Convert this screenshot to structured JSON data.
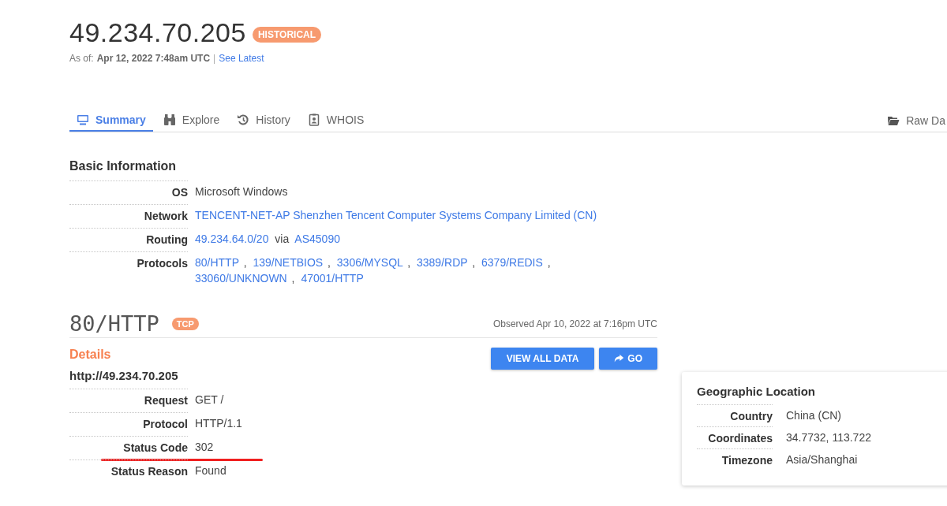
{
  "header": {
    "ip": "49.234.70.205",
    "badge": "HISTORICAL",
    "as_of_label": "As of:",
    "as_of": "Apr 12, 2022 7:48am UTC",
    "separator": "|",
    "latest_link": "See Latest"
  },
  "tabs": [
    {
      "label": "Summary",
      "selected": true
    },
    {
      "label": "Explore",
      "selected": false
    },
    {
      "label": "History",
      "selected": false
    },
    {
      "label": "WHOIS",
      "selected": false
    }
  ],
  "raw_data": {
    "label": "Raw Da"
  },
  "basic_information": {
    "title": "Basic Information",
    "rows": [
      {
        "label": "OS",
        "kind": "text",
        "value": "Microsoft Windows"
      },
      {
        "label": "Network",
        "kind": "link",
        "value": "TENCENT-NET-AP Shenzhen Tencent Computer Systems Company Limited (CN)"
      },
      {
        "label": "Routing",
        "kind": "route",
        "value": "49.234.64.0/20",
        "via": "via",
        "asn": "AS45090"
      },
      {
        "label": "Protocols",
        "kind": "links",
        "separator": ",",
        "links": [
          "80/HTTP",
          "139/NETBIOS",
          "3306/MYSQL",
          "3389/RDP",
          "6379/REDIS",
          "33060/UNKNOWN",
          "47001/HTTP"
        ]
      }
    ]
  },
  "service": {
    "port": "80/HTTP",
    "transport": "TCP",
    "observed": "Observed Apr 10, 2022 at 7:16pm UTC",
    "section": "Details",
    "url": "http://49.234.70.205",
    "buttons": [
      {
        "label": "VIEW ALL DATA",
        "kind": "plain"
      },
      {
        "label": "GO",
        "kind": "share"
      }
    ],
    "rows": [
      {
        "label": "Request",
        "value": "GET /",
        "underlined": false
      },
      {
        "label": "Protocol",
        "value": "HTTP/1.1",
        "underlined": false
      },
      {
        "label": "Status Code",
        "value": "302",
        "underlined": true
      },
      {
        "label": "Status Reason",
        "value": "Found",
        "underlined": false
      }
    ]
  },
  "geo": {
    "title": "Geographic Location",
    "rows": [
      {
        "label": "Country",
        "value": "China (CN)"
      },
      {
        "label": "Coordinates",
        "value": "34.7732, 113.722"
      },
      {
        "label": "Timezone",
        "value": "Asia/Shanghai"
      }
    ]
  }
}
